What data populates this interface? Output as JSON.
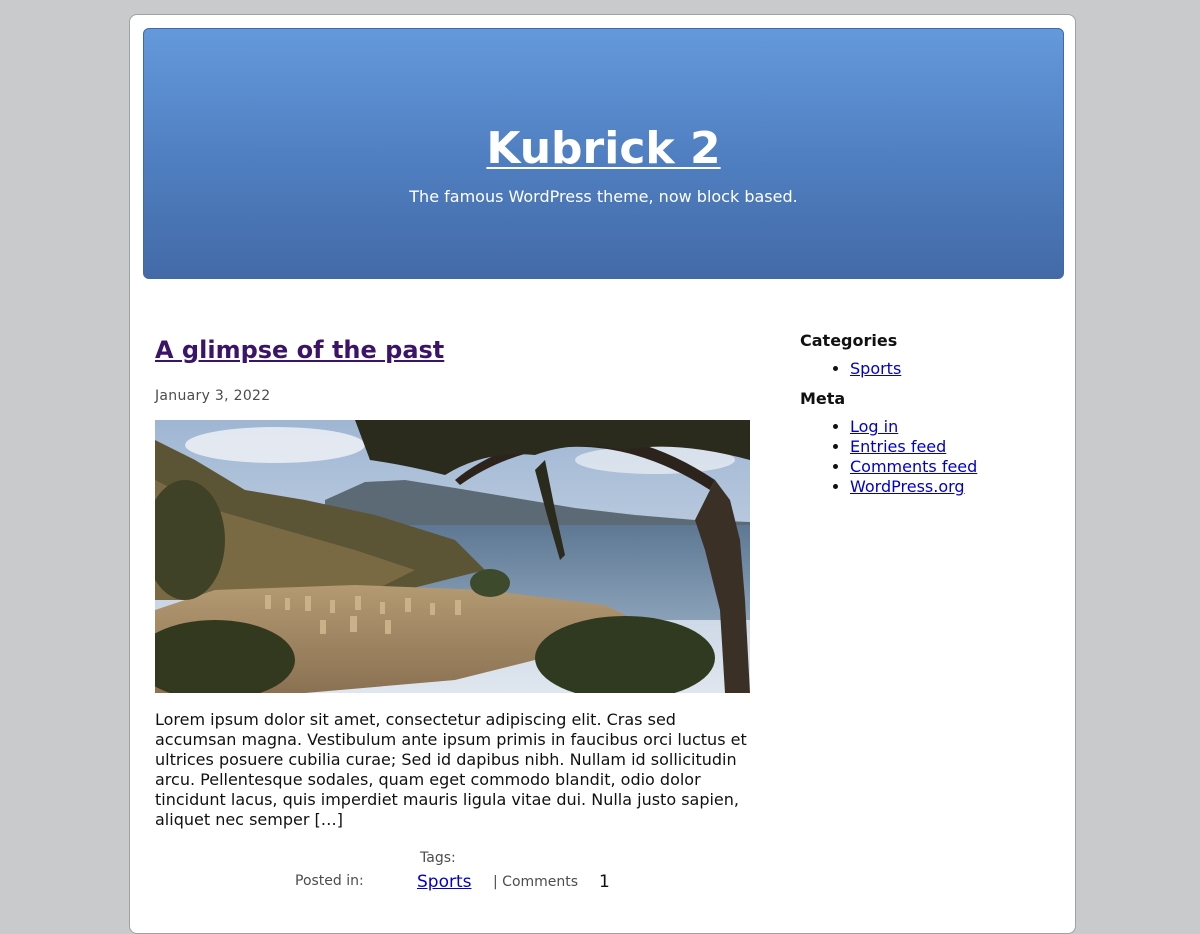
{
  "header": {
    "site_title": "Kubrick 2",
    "tagline": "The famous WordPress theme, now block based."
  },
  "post": {
    "title": "A glimpse of the past",
    "date": "January 3, 2022",
    "excerpt": "Lorem ipsum dolor sit amet, consectetur adipiscing elit. Cras sed accumsan magna. Vestibulum ante ipsum primis in faucibus orci luctus et ultrices posuere cubilia curae; Sed id dapibus nibh. Nullam id sollicitudin arcu. Pellentesque sodales, quam eget commodo blandit, odio dolor tincidunt lacus, quis imperdiet mauris ligula vitae dui. Nulla justo sapien, aliquet nec semper […]",
    "footer": {
      "tags_label": "Tags:",
      "posted_in_label": "Posted in:",
      "category": "Sports",
      "comments_label": "| Comments",
      "comments_count": "1"
    }
  },
  "sidebar": {
    "categories_title": "Categories",
    "categories": [
      "Sports"
    ],
    "meta_title": "Meta",
    "meta_links": [
      "Log in",
      "Entries feed",
      "Comments feed",
      "WordPress.org"
    ]
  },
  "colors": {
    "header_top": "#6499dc",
    "header_bottom": "#436aa7",
    "background": "#c9cacc",
    "link": "#0000cc",
    "visited_link": "#3b1369"
  }
}
